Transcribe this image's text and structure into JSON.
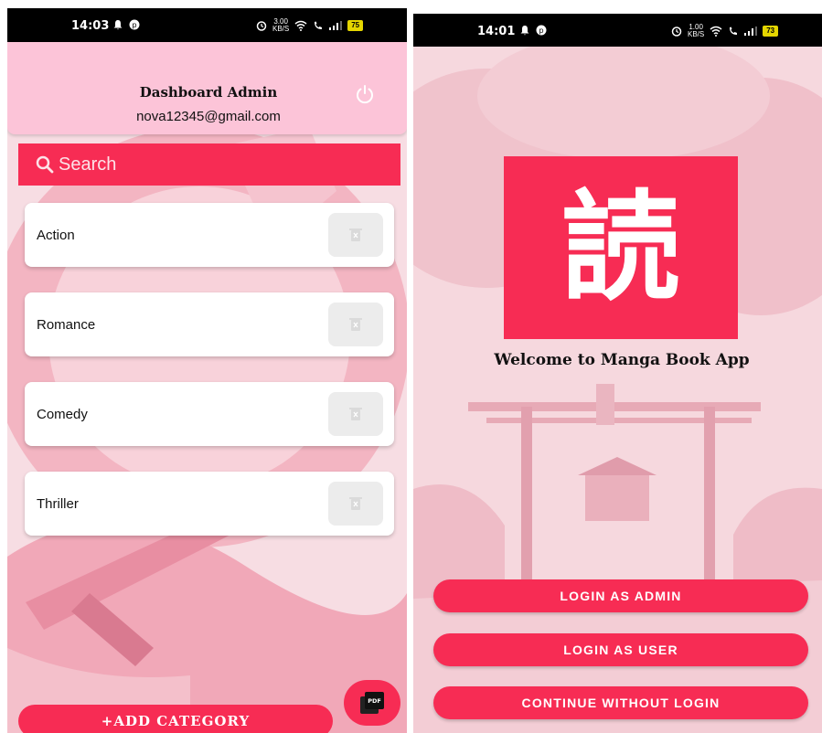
{
  "left_screen": {
    "status_bar": {
      "time": "14:03",
      "speed": "3.00",
      "speed_unit": "KB/S",
      "battery": "75"
    },
    "header": {
      "title": "Dashboard Admin",
      "email": "nova12345@gmail.com",
      "logout_icon": "power-icon"
    },
    "search": {
      "placeholder": "Search",
      "icon": "search-icon"
    },
    "categories": [
      {
        "label": "Action"
      },
      {
        "label": "Romance"
      },
      {
        "label": "Comedy"
      },
      {
        "label": "Thriller"
      }
    ],
    "add_category_label": "+ADD CATEGORY",
    "pdf_fab_icon": "pdf-icon"
  },
  "right_screen": {
    "status_bar": {
      "time": "14:01",
      "speed": "1.00",
      "speed_unit": "KB/S",
      "battery": "73"
    },
    "logo_glyph": "読",
    "welcome_text": "Welcome to Manga Book App",
    "buttons": {
      "login_admin": "LOGIN AS ADMIN",
      "login_user": "LOGIN AS USER",
      "continue_guest": "CONTINUE WITHOUT LOGIN"
    }
  },
  "colors": {
    "accent": "#f72c54",
    "header_pink": "#fcc4d8",
    "background_pink": "#f7dbe1"
  }
}
